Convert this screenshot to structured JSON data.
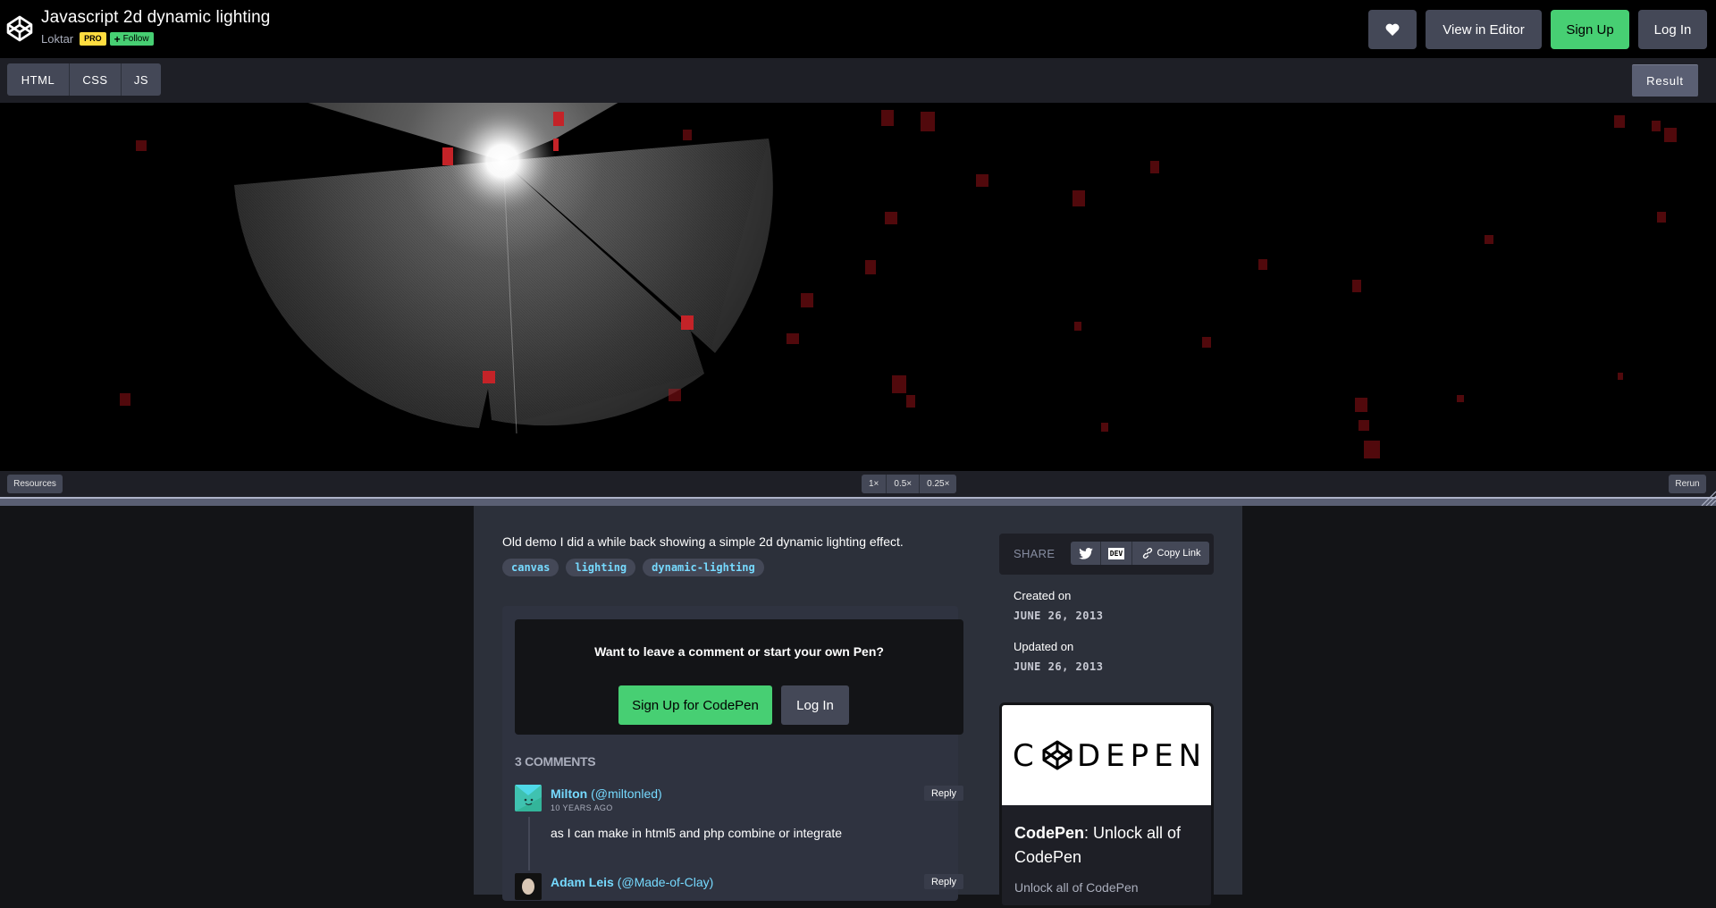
{
  "header": {
    "title": "Javascript 2d dynamic lighting",
    "author": "Loktar",
    "pro_badge": "PRO",
    "follow_label": "Follow",
    "buttons": {
      "heart_icon": "heart-icon",
      "view_in_editor": "View in Editor",
      "sign_up": "Sign Up",
      "log_in": "Log In"
    }
  },
  "editor_tabs": {
    "tabs": [
      "HTML",
      "CSS",
      "JS"
    ],
    "result": "Result"
  },
  "preview_bar": {
    "resources": "Resources",
    "zoom_options": [
      "1×",
      "0.5×",
      "0.25×"
    ],
    "rerun": "Rerun"
  },
  "pen": {
    "description": "Old demo I did a while back showing a simple 2d dynamic lighting effect.",
    "tags": [
      "canvas",
      "lighting",
      "dynamic-lighting"
    ]
  },
  "cta": {
    "title": "Want to leave a comment or start your own Pen?",
    "sign_up": "Sign Up for CodePen",
    "log_in": "Log In"
  },
  "comments": {
    "count_label": "3 COMMENTS",
    "items": [
      {
        "name": "Milton",
        "handle": "(@miltonled)",
        "time": "10 YEARS AGO",
        "body": "as I can make in html5 and php combine or integrate",
        "reply": "Reply"
      },
      {
        "name": "Adam Leis",
        "handle": "(@Made-of-Clay)",
        "time": "",
        "body": "",
        "reply": "Reply"
      }
    ]
  },
  "sidebar": {
    "share_label": "SHARE",
    "share_buttons": {
      "twitter_icon": "twitter-icon",
      "dev_label": "DEV",
      "copy_link": "Copy Link"
    },
    "created_label": "Created on",
    "created_date": "JUNE 26, 2013",
    "updated_label": "Updated on",
    "updated_date": "JUNE 26, 2013",
    "ad": {
      "logo_text": "CODEPEN",
      "title_bold": "CodePen",
      "title_rest": ": Unlock all of CodePen",
      "subtitle": "Unlock all of CodePen"
    }
  },
  "colors": {
    "green": "#47cf73",
    "pro_yellow": "#ffdd40",
    "link_blue": "#76daff",
    "button_gray": "#444857",
    "panel": "#2c303a",
    "block_red": "#b3141a"
  }
}
